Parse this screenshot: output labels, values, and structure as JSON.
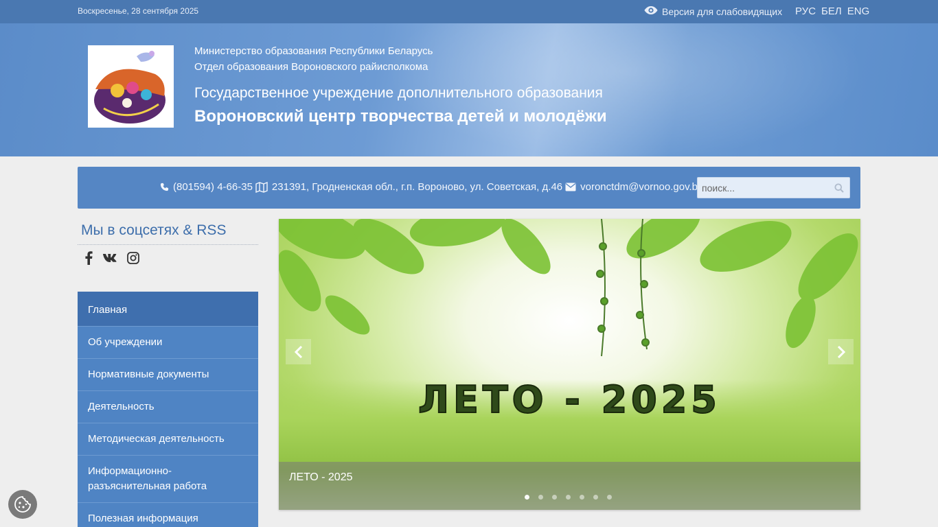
{
  "topbar": {
    "date": "Воскресенье, 28 сентября 2025",
    "low_vision_label": "Версия для слабовидящих",
    "languages": [
      "РУС",
      "БЕЛ",
      "ENG"
    ]
  },
  "header": {
    "ministry": "Министерство образования Республики Беларусь",
    "department": "Отдел образования Вороновского райисполкома",
    "institution_type": "Государственное учреждение дополнительного образования",
    "institution_name": "Вороновский центр творчества детей и молодёжи"
  },
  "contacts": {
    "phone": "(801594) 4-66-35",
    "address": "231391, Гродненская обл., г.п. Вороново, ул. Советская, д.46",
    "email": "voronctdm@vornoo.gov.by"
  },
  "search": {
    "placeholder": "поиск..."
  },
  "social": {
    "title": "Мы в соцсетях & RSS",
    "icons": [
      "facebook-icon",
      "vk-icon",
      "instagram-icon"
    ]
  },
  "menu": {
    "items": [
      "Главная",
      "Об учреждении",
      "Нормативные документы",
      "Деятельность",
      "Методическая деятельность",
      "Информационно-разъяснительная работа",
      "Полезная информация"
    ]
  },
  "slider": {
    "headline": "ЛЕТО - 2025",
    "caption": "ЛЕТО - 2025",
    "slide_count": 7,
    "active_slide": 1
  },
  "colors": {
    "topbar": "#4a78b1",
    "header": "#5b8cc9",
    "menu": "#4f84c4",
    "menu_active": "#3f6fae",
    "social_title": "#3d6eab"
  }
}
